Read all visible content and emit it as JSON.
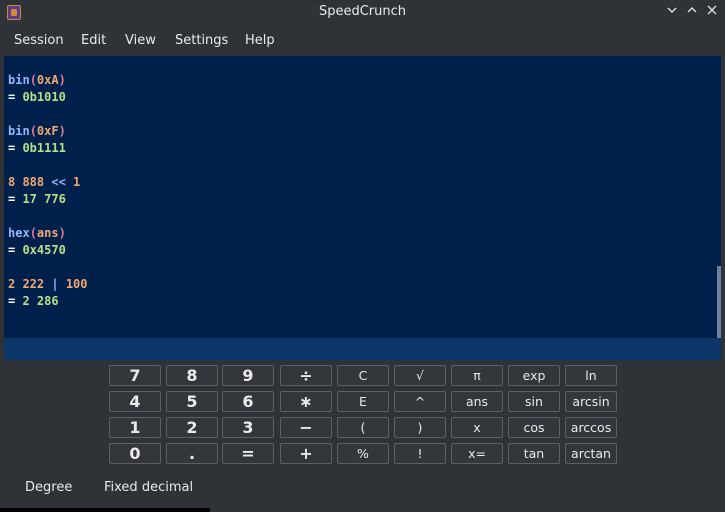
{
  "window": {
    "title": "SpeedCrunch",
    "controls": [
      "chevron-down-icon",
      "chevron-up-icon",
      "close-icon"
    ]
  },
  "menu": [
    "Session",
    "Edit",
    "View",
    "Settings",
    "Help"
  ],
  "history": [
    {
      "expr": [
        {
          "t": "bin",
          "c": "fn"
        },
        {
          "t": "(",
          "c": "par"
        },
        {
          "t": "0xA",
          "c": "num"
        },
        {
          "t": ")",
          "c": "par"
        }
      ],
      "result": "0b1010"
    },
    {
      "expr": [
        {
          "t": "bin",
          "c": "fn"
        },
        {
          "t": "(",
          "c": "par"
        },
        {
          "t": "0xF",
          "c": "num"
        },
        {
          "t": ")",
          "c": "par"
        }
      ],
      "result": "0b1111"
    },
    {
      "expr": [
        {
          "t": "8 888",
          "c": "num"
        },
        {
          "t": " << ",
          "c": "op"
        },
        {
          "t": "1",
          "c": "num"
        }
      ],
      "result": "17 776"
    },
    {
      "expr": [
        {
          "t": "hex",
          "c": "fn"
        },
        {
          "t": "(",
          "c": "par"
        },
        {
          "t": "ans",
          "c": "num"
        },
        {
          "t": ")",
          "c": "par"
        }
      ],
      "result": "0x4570"
    },
    {
      "expr": [
        {
          "t": "2 222",
          "c": "num"
        },
        {
          "t": " | ",
          "c": "op"
        },
        {
          "t": "100",
          "c": "num"
        }
      ],
      "result": "2 286"
    }
  ],
  "result_prefix": "= ",
  "editor_value": "",
  "keypad": {
    "rows": [
      [
        "7",
        "8",
        "9",
        "÷",
        "C",
        "√",
        "π",
        "exp",
        "ln"
      ],
      [
        "4",
        "5",
        "6",
        "∗",
        "E",
        "^",
        "ans",
        "sin",
        "arcsin"
      ],
      [
        "1",
        "2",
        "3",
        "−",
        "(",
        ")",
        "x",
        "cos",
        "arccos"
      ],
      [
        "0",
        ".",
        "=",
        "+",
        "%",
        "!",
        "x=",
        "tan",
        "arctan"
      ]
    ]
  },
  "status": {
    "angle_mode": "Degree",
    "result_format": "Fixed decimal"
  },
  "colors": {
    "display_background": "#00204c",
    "editor_background": "#0c3669",
    "function": "#8fb8ff",
    "number": "#f0a870",
    "parenthesis": "#e07a9a",
    "result": "#b8e08a"
  }
}
